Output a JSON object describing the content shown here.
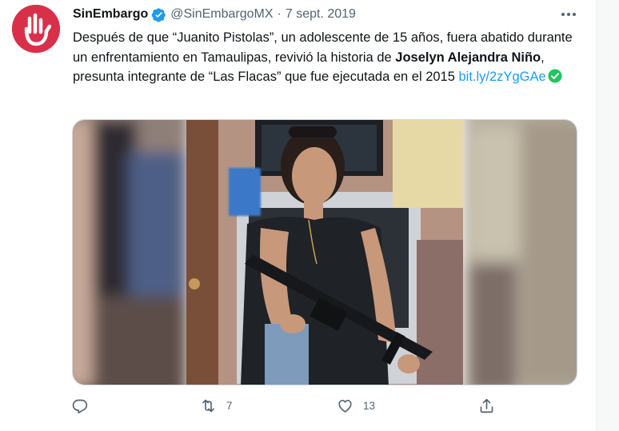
{
  "tweet": {
    "display_name": "SinEmbargo",
    "handle": "@SinEmbargoMX",
    "separator": "·",
    "date": "7 sept. 2019",
    "text_part1": "Después de que “Juanito Pistolas”, un adolescente de 15 años, fuera abatido durante un enfrentamiento en Tamaulipas, revivió la historia de ",
    "text_bold": "Joselyn Alejandra Niño",
    "text_part2": ", presunta integrante de “Las Flacas” que fue ejecutada en el 2015 ",
    "link": "bit.ly/2zYgGAe"
  },
  "actions": {
    "reply_count": "",
    "retweet_count": "7",
    "like_count": "13"
  },
  "icons": {
    "avatar": "sinembargo-logo",
    "verified": "verified-badge-icon",
    "more": "more-options-icon",
    "reply": "reply-icon",
    "retweet": "retweet-icon",
    "like": "heart-icon",
    "share": "share-icon"
  },
  "colors": {
    "brand_avatar": "#d9304a",
    "link": "#1d9bf0",
    "verified": "#1d9bf0",
    "check_emoji": "#22c55e",
    "secondary_text": "#536471"
  }
}
